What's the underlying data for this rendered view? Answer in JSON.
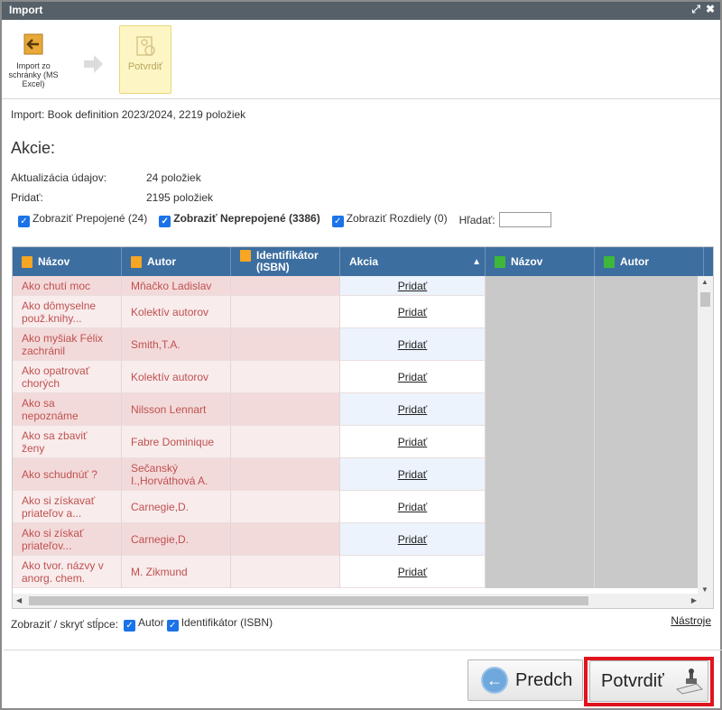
{
  "window": {
    "title": "Import"
  },
  "toolbar": {
    "import_label": "Import zo schránky (MS Excel)",
    "confirm_label": "Potvrdiť"
  },
  "info": "Import: Book definition 2023/2024, 2219 položiek",
  "actions_heading": "Akcie:",
  "summary": [
    {
      "label": "Aktualizácia údajov:",
      "value": "24 položiek"
    },
    {
      "label": "Pridať:",
      "value": "2195 položiek"
    }
  ],
  "filters": {
    "linked": "Zobraziť Prepojené (24)",
    "unlinked": "Zobraziť Neprepojené (3386)",
    "diffs": "Zobraziť Rozdiely (0)",
    "search_label": "Hľadať:",
    "search_value": ""
  },
  "grid": {
    "headers": [
      "Názov",
      "Autor",
      "Identifikátor (ISBN)",
      "Akcia",
      "Názov",
      "Autor"
    ],
    "sort_indicator": "▲",
    "rows": [
      {
        "title": "Ako chutí moc",
        "author": "Mňačko Ladislav",
        "isbn": "",
        "action": "Pridať"
      },
      {
        "title": "Ako dômyselne použ.knihy...",
        "author": "Kolektív autorov",
        "isbn": "",
        "action": "Pridať"
      },
      {
        "title": "Ako myšiak Félix zachránil",
        "author": "Smith,T.A.",
        "isbn": "",
        "action": "Pridať"
      },
      {
        "title": "Ako opatrovať chorých",
        "author": "Kolektív autorov",
        "isbn": "",
        "action": "Pridať"
      },
      {
        "title": "Ako sa nepoznáme",
        "author": "Nilsson Lennart",
        "isbn": "",
        "action": "Pridať"
      },
      {
        "title": "Ako sa zbaviť ženy",
        "author": "Fabre Dominique",
        "isbn": "",
        "action": "Pridať"
      },
      {
        "title": "Ako schudnúť ?",
        "author": "Sečanský I.,Horváthová A.",
        "isbn": "",
        "action": "Pridať"
      },
      {
        "title": "Ako si získavať priateľov a...",
        "author": "Carnegie,D.",
        "isbn": "",
        "action": "Pridať"
      },
      {
        "title": "Ako si získať priateľov...",
        "author": "Carnegie,D.",
        "isbn": "",
        "action": "Pridať"
      },
      {
        "title": "Ako tvor. názvy v anorg. chem.",
        "author": "M. Zikmund",
        "isbn": "",
        "action": "Pridať"
      }
    ]
  },
  "columns_toggle": {
    "label": "Zobraziť / skryť stĺpce:",
    "author": "Autor",
    "isbn": "Identifikátor (ISBN)"
  },
  "tools_link": "Nástroje",
  "buttons": {
    "prev": "Predch",
    "confirm": "Potvrdiť"
  },
  "colors": {
    "titlebar": "#556069",
    "grid_header": "#3d6ea0",
    "highlight": "#e0141e",
    "checkbox": "#1a73e8"
  }
}
